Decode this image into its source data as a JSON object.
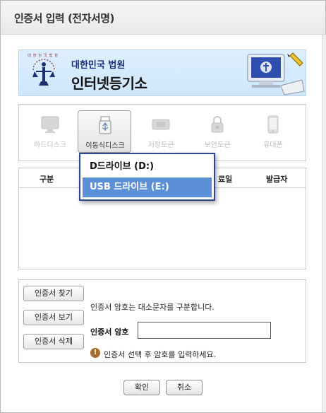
{
  "dialog": {
    "title": "인증서 입력 (전자서명)"
  },
  "banner": {
    "emblem_text": "대한민국법원",
    "org_name": "대한민국 법원",
    "service_name": "인터넷등기소"
  },
  "media": {
    "items": [
      {
        "label": "하드디스크",
        "icon": "monitor-icon",
        "state": "disabled"
      },
      {
        "label": "이동식디스크",
        "icon": "usb-drive-icon",
        "state": "selected"
      },
      {
        "label": "저장토큰",
        "icon": "token-icon",
        "state": "disabled"
      },
      {
        "label": "보안토큰",
        "icon": "lock-icon",
        "state": "disabled"
      },
      {
        "label": "휴대폰",
        "icon": "phone-icon",
        "state": "disabled"
      }
    ]
  },
  "drive_menu": {
    "options": [
      "D드라이브 (D:)",
      "USB 드라이브 (E:)"
    ],
    "selected_index": 1
  },
  "cert_table": {
    "columns": [
      "구분",
      "료일",
      "발급자"
    ],
    "rows": []
  },
  "actions": {
    "find_label": "인증서 찾기",
    "view_label": "인증서 보기",
    "delete_label": "인증서 삭제"
  },
  "password": {
    "note": "인증서 암호는 대소문자를 구분합니다.",
    "label": "인증서 암호",
    "value": "",
    "warning": "인증서 선택 후 암호를 입력하세요.",
    "warning_icon": "!"
  },
  "footer": {
    "ok_label": "확인",
    "cancel_label": "취소"
  },
  "colors": {
    "accent": "#2e4a8f",
    "selected_option": "#5b8fd6",
    "warning": "#a86d2e"
  }
}
